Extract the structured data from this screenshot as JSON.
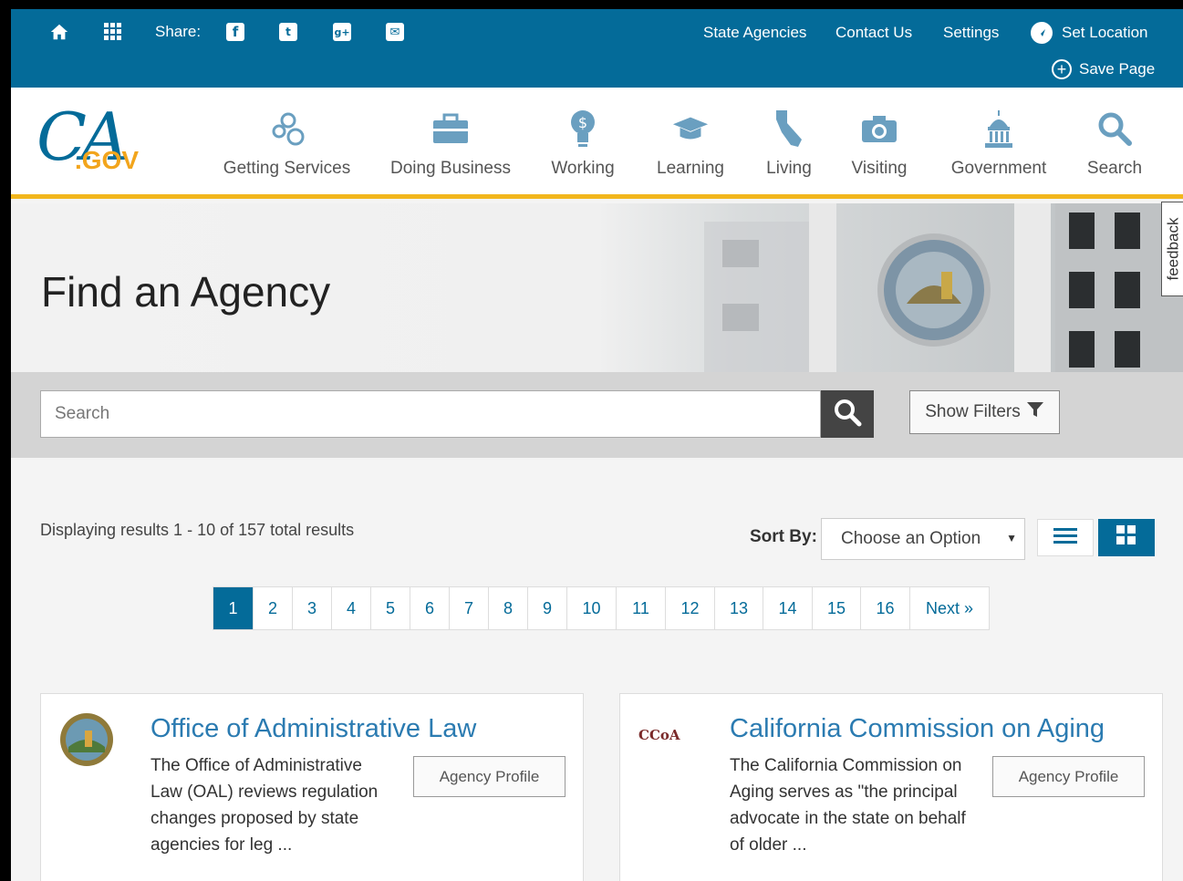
{
  "utility_bar": {
    "share_label": "Share:",
    "links": [
      "State Agencies",
      "Contact Us",
      "Settings"
    ],
    "set_location": "Set Location",
    "save_page": "Save Page"
  },
  "logo": {
    "main": "CA",
    "suffix": ".GOV"
  },
  "nav": {
    "items": [
      {
        "label": "Getting Services",
        "icon": "gears-icon"
      },
      {
        "label": "Doing Business",
        "icon": "briefcase-icon"
      },
      {
        "label": "Working",
        "icon": "lightbulb-dollar-icon"
      },
      {
        "label": "Learning",
        "icon": "graduation-cap-icon"
      },
      {
        "label": "Living",
        "icon": "california-icon"
      },
      {
        "label": "Visiting",
        "icon": "camera-icon"
      },
      {
        "label": "Government",
        "icon": "capitol-icon"
      },
      {
        "label": "Search",
        "icon": "search-icon"
      }
    ]
  },
  "hero": {
    "title": "Find an Agency"
  },
  "search": {
    "placeholder": "Search",
    "filters_label": "Show Filters"
  },
  "results": {
    "summary": "Displaying results 1 - 10 of 157 total results",
    "sort_label": "Sort By:",
    "sort_value": "Choose an Option"
  },
  "pagination": {
    "pages": [
      "1",
      "2",
      "3",
      "4",
      "5",
      "6",
      "7",
      "8",
      "9",
      "10",
      "11",
      "12",
      "13",
      "14",
      "15",
      "16"
    ],
    "active": "1",
    "next": "Next »"
  },
  "cards": [
    {
      "title": "Office of Administrative Law",
      "description": "The Office of Administrative Law (OAL) reviews regulation changes proposed by state agencies for leg ...",
      "button": "Agency Profile"
    },
    {
      "title": "California Commission on Aging",
      "description": "The California Commission on Aging serves as \"the principal advocate in the state on behalf of older ...",
      "button": "Agency Profile",
      "logo_text": "CCoA"
    }
  ],
  "feedback": "feedback",
  "colors": {
    "primary": "#046b99",
    "accent": "#f2b61d",
    "link": "#2b7bb1"
  }
}
